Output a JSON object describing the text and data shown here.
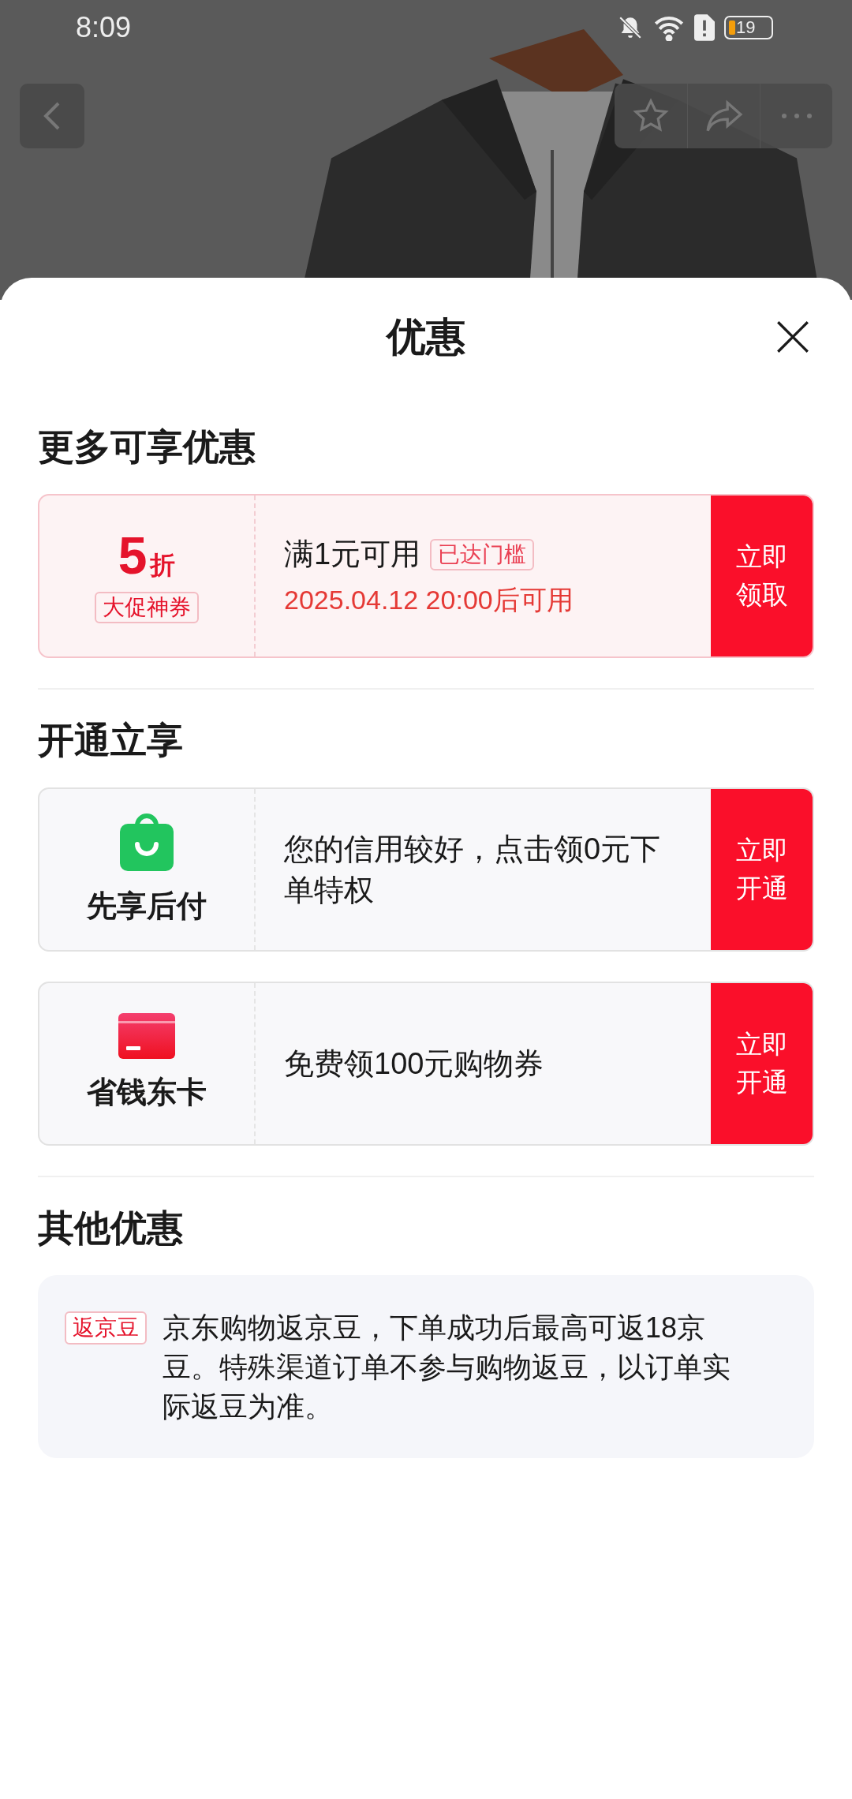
{
  "status_bar": {
    "time": "8:09",
    "battery": "19"
  },
  "sheet": {
    "title": "优惠"
  },
  "sections": [
    {
      "title": "更多可享优惠",
      "cards": [
        {
          "kind": "coupon",
          "value": "5",
          "unit": "折",
          "tag": "大促神券",
          "condition": "满1元可用",
          "badge": "已达门槛",
          "note": "2025.04.12 20:00后可用",
          "action": "立即领取"
        }
      ]
    },
    {
      "title": "开通立享",
      "cards": [
        {
          "kind": "service",
          "name": "先享后付",
          "description": "您的信用较好，点击领0元下单特权",
          "action": "立即开通"
        },
        {
          "kind": "service",
          "name": "省钱东卡",
          "description": "免费领100元购物券",
          "action": "立即开通"
        }
      ]
    },
    {
      "title": "其他优惠",
      "cards": [
        {
          "kind": "info",
          "tag": "返京豆",
          "text": "京东购物返京豆，下单成功后最高可返18京豆。特殊渠道订单不参与购物返豆，以订单实际返豆为准。"
        }
      ]
    }
  ]
}
